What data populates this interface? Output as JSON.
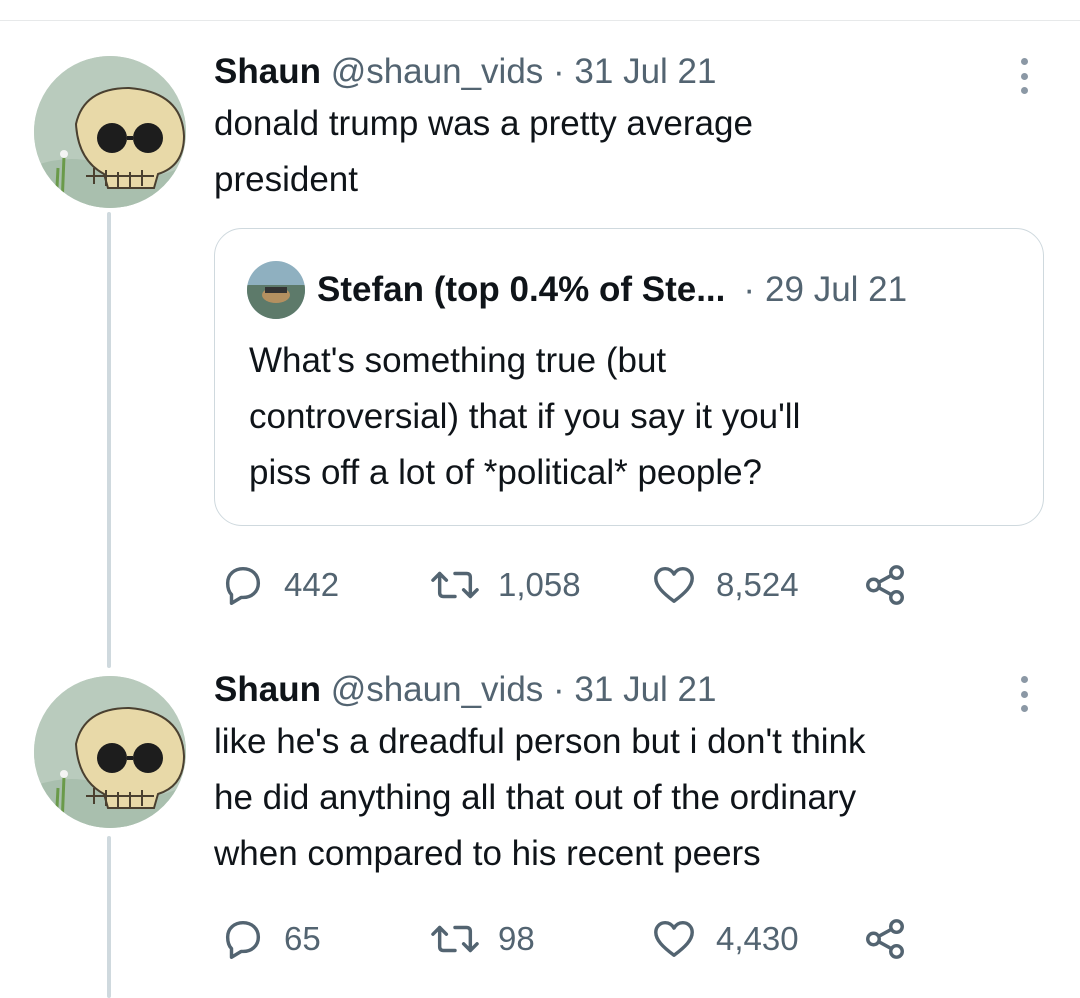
{
  "tweets": [
    {
      "author_name": "Shaun",
      "handle": "@shaun_vids",
      "separator": "·",
      "date": "31 Jul 21",
      "text_lines": [
        "donald trump was a pretty average",
        "president"
      ],
      "quoted": {
        "author_name": "Stefan (top 0.4% of Ste...",
        "separator": "·",
        "date": "29 Jul 21",
        "text_lines": [
          "What's something true (but",
          "controversial) that if you say it you'll",
          "piss off a lot of *political* people?"
        ]
      },
      "replies": "442",
      "retweets": "1,058",
      "likes": "8,524"
    },
    {
      "author_name": "Shaun",
      "handle": "@shaun_vids",
      "separator": "·",
      "date": "31 Jul 21",
      "text_lines": [
        "like he's a dreadful person but i don't think",
        "he did anything all that out of the ordinary",
        "when compared to his recent peers"
      ],
      "replies": "65",
      "retweets": "98",
      "likes": "4,430"
    }
  ],
  "icons": {
    "reply": "reply-icon",
    "retweet": "retweet-icon",
    "like": "heart-icon",
    "share": "share-icon",
    "more": "more-icon"
  },
  "colors": {
    "text": "#0f1419",
    "muted": "#536471",
    "border": "#cfd9de",
    "avatar_bg": "#b9cbbd"
  }
}
